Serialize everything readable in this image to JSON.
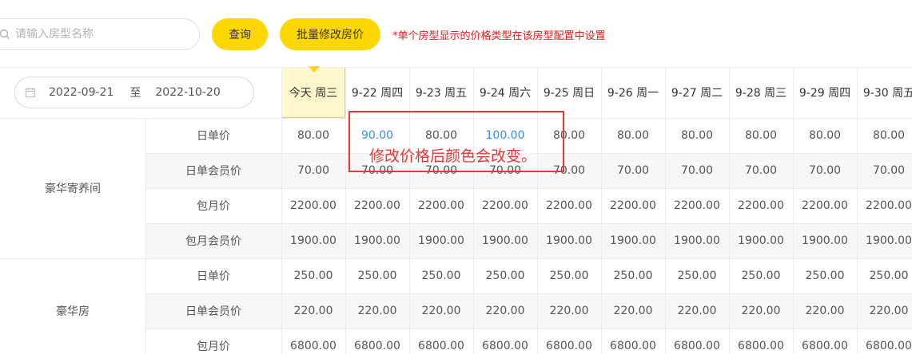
{
  "search": {
    "placeholder": "请输入房型名称"
  },
  "buttons": {
    "query": "查询",
    "batch_edit": "批量修改房价"
  },
  "hint": "*单个房型显示的价格类型在该房型配置中设置",
  "date_range": {
    "start": "2022-09-21",
    "sep": "至",
    "end": "2022-10-20"
  },
  "columns": [
    "今天 周三",
    "9-22 周四",
    "9-23 周五",
    "9-24 周六",
    "9-25 周日",
    "9-26 周一",
    "9-27 周二",
    "9-28 周三",
    "9-29 周四",
    "9-30 周五"
  ],
  "rooms": [
    {
      "name": "豪华寄养间",
      "rows": [
        {
          "type": "日单价",
          "values": [
            "80.00",
            "90.00",
            "80.00",
            "100.00",
            "80.00",
            "80.00",
            "80.00",
            "80.00",
            "80.00",
            "80.00"
          ]
        },
        {
          "type": "日单会员价",
          "values": [
            "70.00",
            "70.00",
            "70.00",
            "70.00",
            "70.00",
            "70.00",
            "70.00",
            "70.00",
            "70.00",
            "70.00"
          ]
        },
        {
          "type": "包月价",
          "values": [
            "2200.00",
            "2200.00",
            "2200.00",
            "2200.00",
            "2200.00",
            "2200.00",
            "2200.00",
            "2200.00",
            "2200.00",
            "2200.00"
          ]
        },
        {
          "type": "包月会员价",
          "values": [
            "1900.00",
            "1900.00",
            "1900.00",
            "1900.00",
            "1900.00",
            "1900.00",
            "1900.00",
            "1900.00",
            "1900.00",
            "1900.00"
          ]
        }
      ]
    },
    {
      "name": "豪华房",
      "rows": [
        {
          "type": "日单价",
          "values": [
            "250.00",
            "250.00",
            "250.00",
            "250.00",
            "250.00",
            "250.00",
            "250.00",
            "250.00",
            "250.00",
            "250.00"
          ]
        },
        {
          "type": "日单会员价",
          "values": [
            "220.00",
            "220.00",
            "220.00",
            "220.00",
            "220.00",
            "220.00",
            "220.00",
            "220.00",
            "220.00",
            "220.00"
          ]
        },
        {
          "type": "包月价",
          "values": [
            "6800.00",
            "6800.00",
            "6800.00",
            "6800.00",
            "6800.00",
            "6800.00",
            "6800.00",
            "6800.00",
            "6800.00",
            "6800.00"
          ]
        }
      ]
    }
  ],
  "modified_cells": [
    {
      "room": 0,
      "row": 0,
      "col": 1
    },
    {
      "room": 0,
      "row": 0,
      "col": 3
    }
  ],
  "colors": {
    "accent": "#ffd700",
    "modified": "#3a8ee6",
    "hint": "#e02020",
    "annotation": "#e53935"
  },
  "annotation": {
    "text": "修改价格后颜色会改变。"
  },
  "icons": {
    "search": "search-icon",
    "calendar": "calendar-icon"
  }
}
